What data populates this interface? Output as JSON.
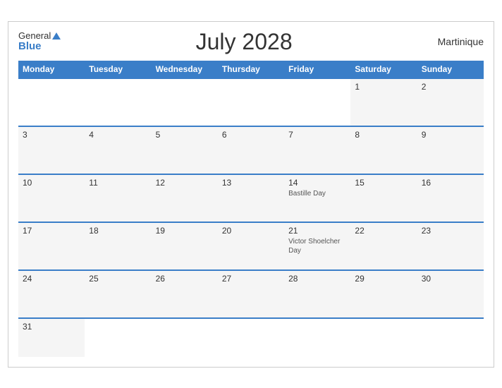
{
  "header": {
    "logo_general": "General",
    "logo_blue": "Blue",
    "title": "July 2028",
    "region": "Martinique"
  },
  "weekdays": [
    "Monday",
    "Tuesday",
    "Wednesday",
    "Thursday",
    "Friday",
    "Saturday",
    "Sunday"
  ],
  "weeks": [
    [
      {
        "day": "",
        "empty": true
      },
      {
        "day": "",
        "empty": true
      },
      {
        "day": "",
        "empty": true
      },
      {
        "day": "",
        "empty": true
      },
      {
        "day": "",
        "empty": true
      },
      {
        "day": "1",
        "event": ""
      },
      {
        "day": "2",
        "event": ""
      }
    ],
    [
      {
        "day": "3",
        "event": ""
      },
      {
        "day": "4",
        "event": ""
      },
      {
        "day": "5",
        "event": ""
      },
      {
        "day": "6",
        "event": ""
      },
      {
        "day": "7",
        "event": ""
      },
      {
        "day": "8",
        "event": ""
      },
      {
        "day": "9",
        "event": ""
      }
    ],
    [
      {
        "day": "10",
        "event": ""
      },
      {
        "day": "11",
        "event": ""
      },
      {
        "day": "12",
        "event": ""
      },
      {
        "day": "13",
        "event": ""
      },
      {
        "day": "14",
        "event": "Bastille Day"
      },
      {
        "day": "15",
        "event": ""
      },
      {
        "day": "16",
        "event": ""
      }
    ],
    [
      {
        "day": "17",
        "event": ""
      },
      {
        "day": "18",
        "event": ""
      },
      {
        "day": "19",
        "event": ""
      },
      {
        "day": "20",
        "event": ""
      },
      {
        "day": "21",
        "event": "Victor Shoelcher Day"
      },
      {
        "day": "22",
        "event": ""
      },
      {
        "day": "23",
        "event": ""
      }
    ],
    [
      {
        "day": "24",
        "event": ""
      },
      {
        "day": "25",
        "event": ""
      },
      {
        "day": "26",
        "event": ""
      },
      {
        "day": "27",
        "event": ""
      },
      {
        "day": "28",
        "event": ""
      },
      {
        "day": "29",
        "event": ""
      },
      {
        "day": "30",
        "event": ""
      }
    ],
    [
      {
        "day": "31",
        "event": ""
      },
      {
        "day": "",
        "empty": true
      },
      {
        "day": "",
        "empty": true
      },
      {
        "day": "",
        "empty": true
      },
      {
        "day": "",
        "empty": true
      },
      {
        "day": "",
        "empty": true
      },
      {
        "day": "",
        "empty": true
      }
    ]
  ]
}
